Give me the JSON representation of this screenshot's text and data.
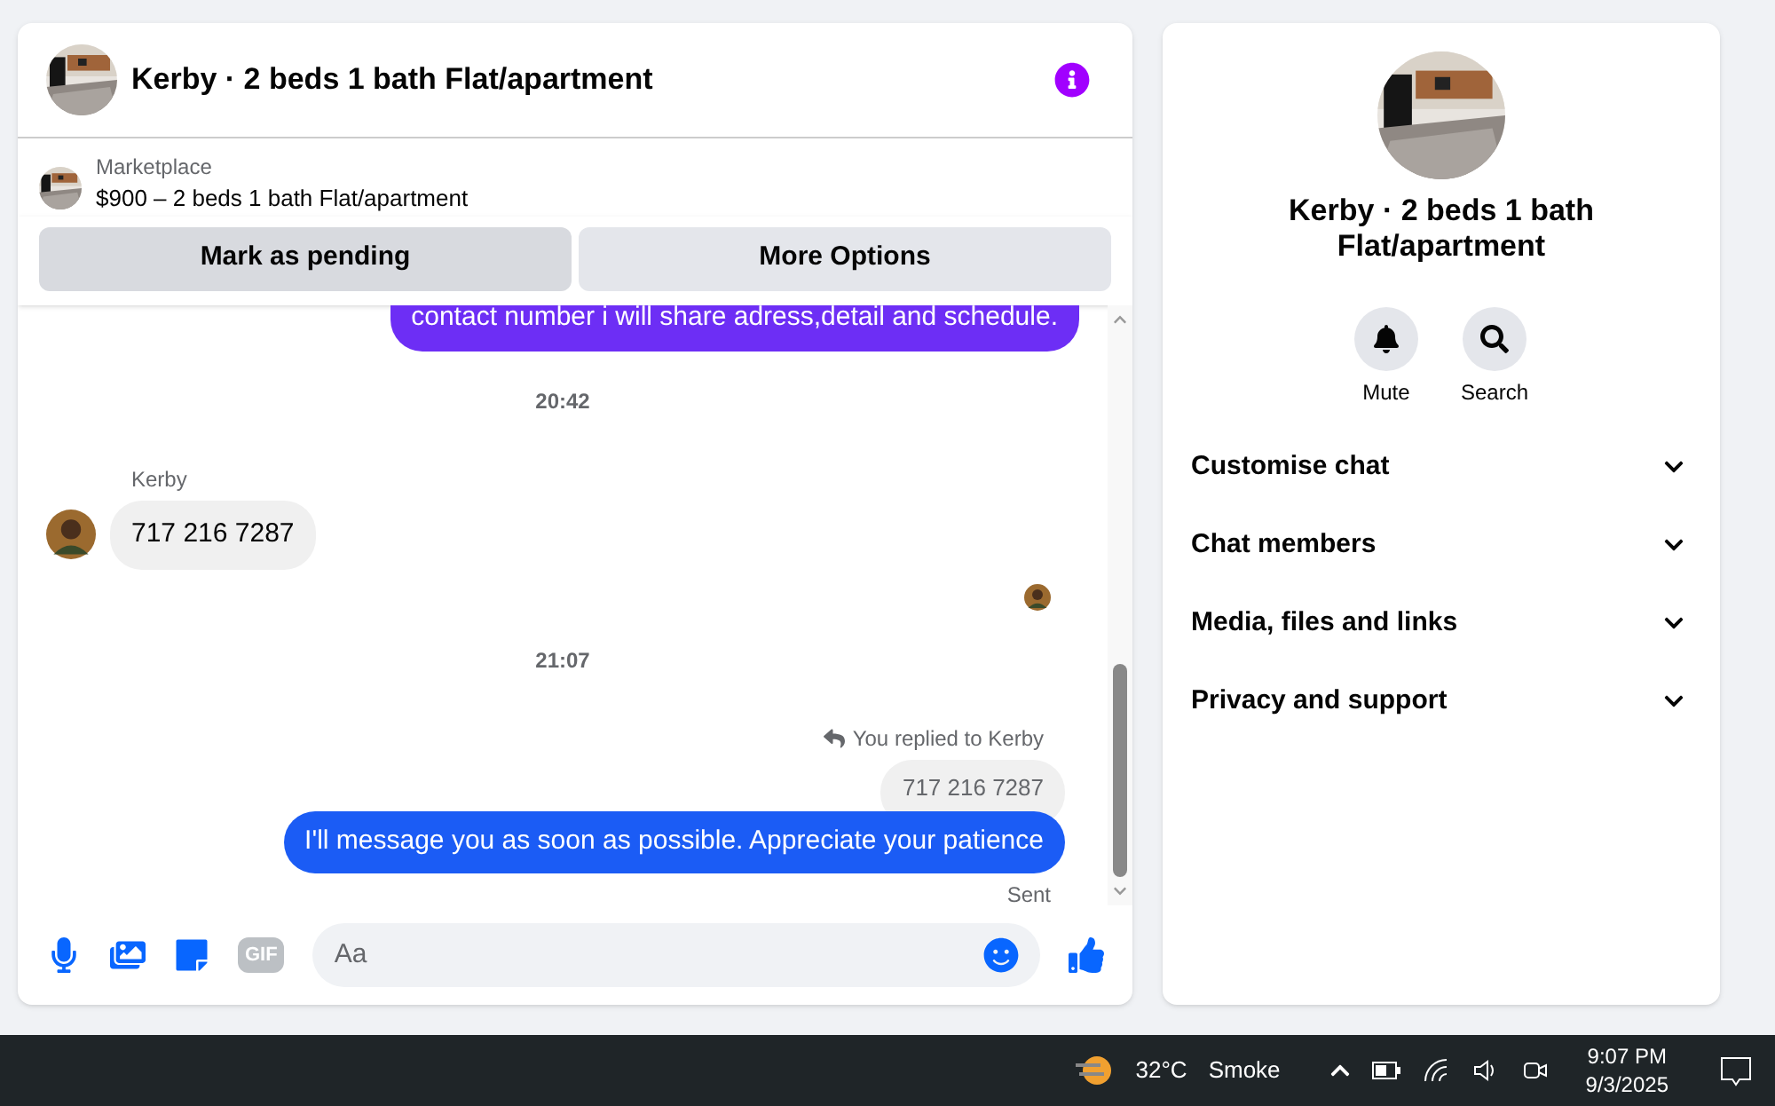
{
  "chat": {
    "title": "Kerby · 2 beds 1 bath Flat/apartment",
    "listing": {
      "source": "Marketplace",
      "summary": "$900 – 2 beds 1 bath Flat/apartment"
    },
    "actions": [
      "Mark as pending",
      "More Options"
    ],
    "messages": [
      {
        "kind": "outgoing",
        "text": "contact number i will share adress,detail and schedule.",
        "color": "#6d2ef5"
      },
      {
        "kind": "time",
        "text": "20:42"
      },
      {
        "kind": "incoming",
        "sender": "Kerby",
        "text": "717 216 7287"
      },
      {
        "kind": "seen"
      },
      {
        "kind": "time",
        "text": "21:07"
      },
      {
        "kind": "reply",
        "note": "You replied to Kerby",
        "quote": "717 216 7287",
        "text": "I'll message you as soon as possible. Appreciate your patience",
        "color": "#1b5cf5",
        "status": "Sent"
      }
    ],
    "composer": {
      "gif_label": "GIF",
      "placeholder": "Aa"
    }
  },
  "details": {
    "title": "Kerby · 2 beds 1 bath Flat/apartment",
    "quick_actions": [
      {
        "kind": "mute",
        "label": "Mute"
      },
      {
        "kind": "search",
        "label": "Search"
      }
    ],
    "sections": [
      {
        "label": "Customise chat",
        "expanded": false
      },
      {
        "label": "Chat members",
        "expanded": false
      },
      {
        "label": "Media, files and links",
        "expanded": false
      },
      {
        "label": "Privacy and support",
        "expanded": false
      }
    ]
  },
  "taskbar": {
    "temperature": "32°C",
    "weather": "Smoke",
    "time": "9:07 PM",
    "date": "9/3/2025"
  }
}
